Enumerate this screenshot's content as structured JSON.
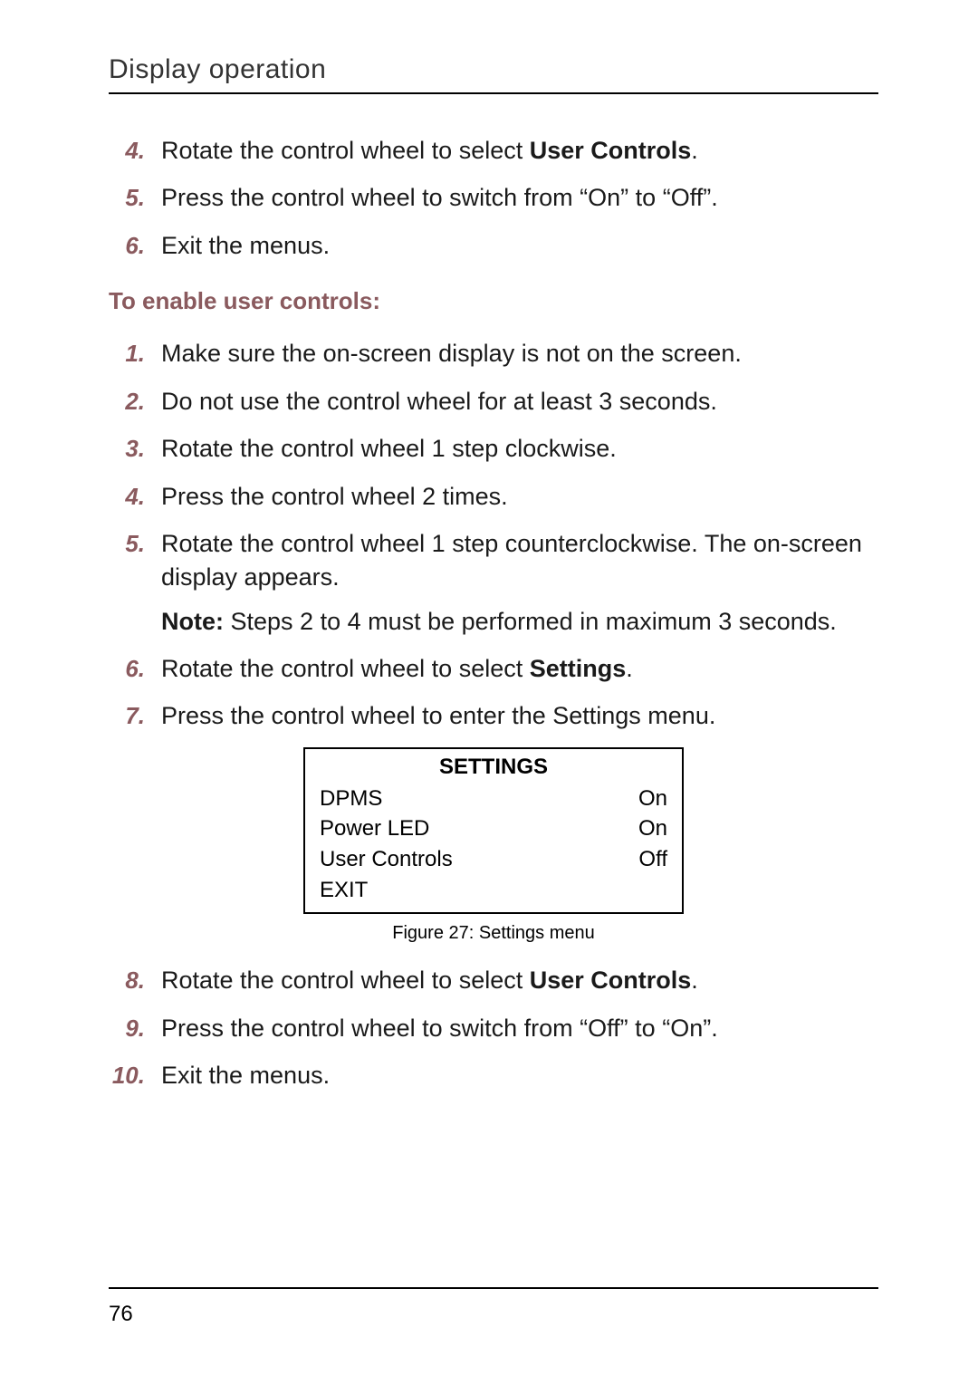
{
  "header": "Display operation",
  "listA": [
    {
      "num": "4.",
      "text_pre": "Rotate the control wheel to select ",
      "bold": "User Controls",
      "text_post": "."
    },
    {
      "num": "5.",
      "text_pre": "Press the control wheel to switch from “On” to “Off”.",
      "bold": "",
      "text_post": ""
    },
    {
      "num": "6.",
      "text_pre": "Exit the menus.",
      "bold": "",
      "text_post": ""
    }
  ],
  "subhead": "To enable user controls:",
  "listB": [
    {
      "num": "1.",
      "text": "Make sure the on-screen display is not on the screen."
    },
    {
      "num": "2.",
      "text": "Do not use the control wheel for at least 3 seconds."
    },
    {
      "num": "3.",
      "text": "Rotate the control wheel 1 step clockwise."
    },
    {
      "num": "4.",
      "text": "Press the control wheel 2 times."
    },
    {
      "num": "5.",
      "text": "Rotate the control wheel 1 step counterclockwise. The on-screen display appears."
    }
  ],
  "note": {
    "label": "Note:",
    "text": " Steps 2 to 4 must be performed in maximum 3 seconds."
  },
  "listC": [
    {
      "num": "6.",
      "text_pre": "Rotate the control wheel to select ",
      "bold": "Settings",
      "text_post": "."
    },
    {
      "num": "7.",
      "text_pre": "Press the control wheel to enter the Settings menu.",
      "bold": "",
      "text_post": ""
    }
  ],
  "settings": {
    "title": "SETTINGS",
    "rows": [
      {
        "label": "DPMS",
        "value": "On"
      },
      {
        "label": "Power LED",
        "value": "On"
      },
      {
        "label": "User Controls",
        "value": "Off"
      },
      {
        "label": "EXIT",
        "value": ""
      }
    ]
  },
  "caption": "Figure 27: Settings menu",
  "listD": [
    {
      "num": "8.",
      "text_pre": "Rotate the control wheel to select ",
      "bold": "User Controls",
      "text_post": "."
    },
    {
      "num": "9.",
      "text_pre": "Press the control wheel to switch from “Off” to “On”.",
      "bold": "",
      "text_post": ""
    },
    {
      "num": "10.",
      "text_pre": "Exit the menus.",
      "bold": "",
      "text_post": ""
    }
  ],
  "page_number": "76"
}
